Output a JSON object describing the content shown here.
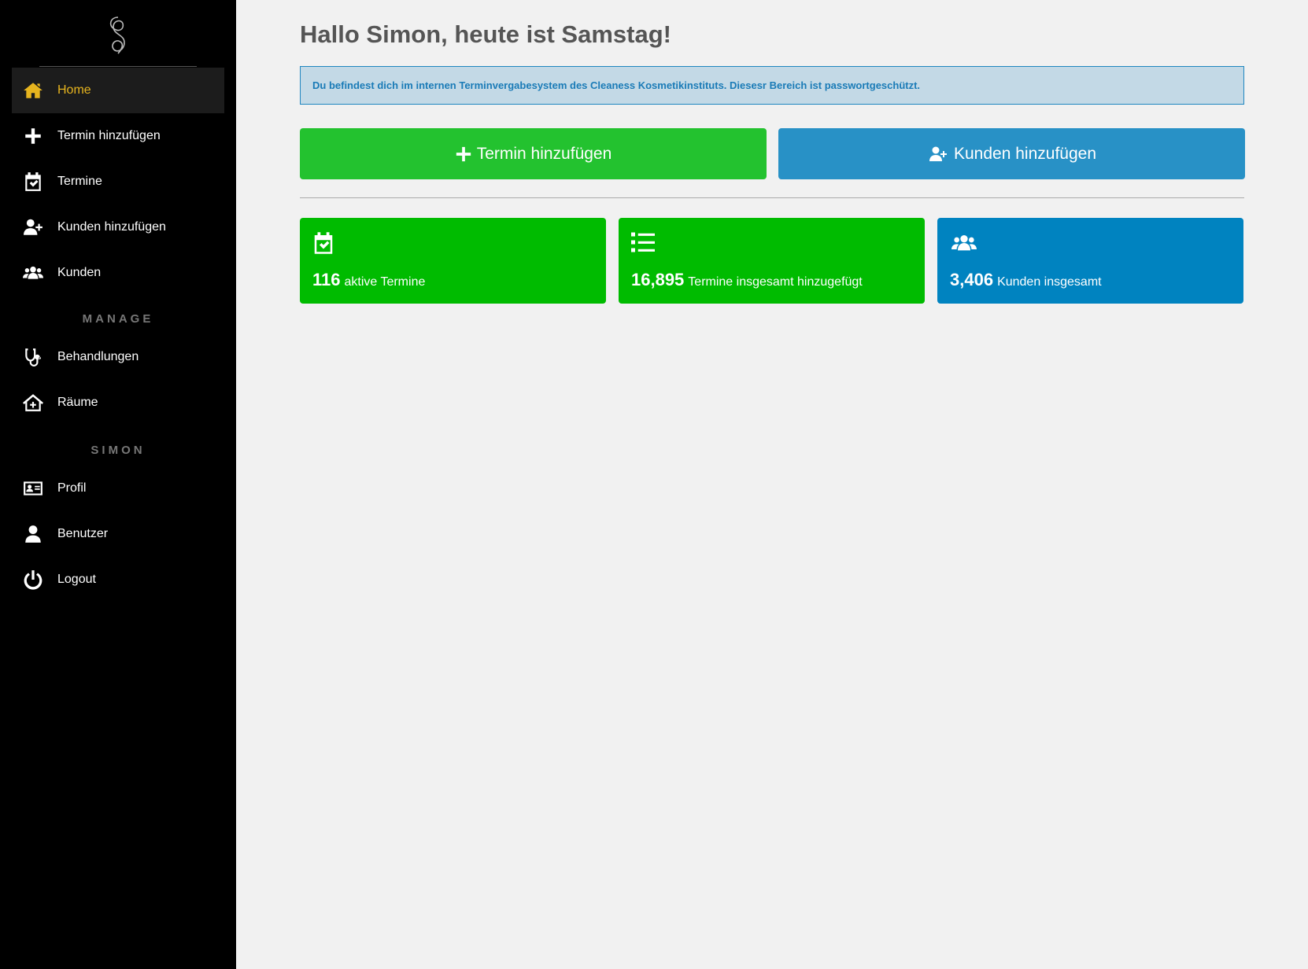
{
  "sidebar": {
    "logo": "logo-flourish",
    "items": [
      {
        "label": "Home",
        "icon": "home-icon"
      },
      {
        "label": "Termin hinzufügen",
        "icon": "plus-icon"
      },
      {
        "label": "Termine",
        "icon": "calendar-check-icon"
      },
      {
        "label": "Kunden hinzufügen",
        "icon": "user-plus-icon"
      },
      {
        "label": "Kunden",
        "icon": "users-icon"
      }
    ],
    "manage_label": "MANAGE",
    "manage_items": [
      {
        "label": "Behandlungen",
        "icon": "stethoscope-icon"
      },
      {
        "label": "Räume",
        "icon": "clinic-house-icon"
      }
    ],
    "user_label": "SIMON",
    "user_items": [
      {
        "label": "Profil",
        "icon": "id-card-icon"
      },
      {
        "label": "Benutzer",
        "icon": "user-icon"
      },
      {
        "label": "Logout",
        "icon": "power-icon"
      }
    ],
    "active_color": "#e6b41e"
  },
  "main": {
    "greeting": "Hallo Simon, heute ist Samstag!",
    "info": "Du befindest dich im internen Terminvergabesystem des Cleaness Kosmetikinstituts. Diesesr Bereich ist passwortgeschützt.",
    "buttons": {
      "add_appointment": "Termin hinzufügen",
      "add_customer": "Kunden hinzufügen"
    },
    "stats": [
      {
        "value": "116",
        "label": "aktive Termine",
        "icon": "calendar-check-icon",
        "color": "#00bb00"
      },
      {
        "value": "16,895",
        "label": "Termine insgesamt hinzugefügt",
        "icon": "list-icon",
        "color": "#00bb00"
      },
      {
        "value": "3,406",
        "label": "Kunden insgesamt",
        "icon": "users-icon",
        "color": "#0083c0"
      }
    ]
  },
  "colors": {
    "green_button": "#23c22f",
    "blue_button": "#2891c6",
    "info_bg": "#c3d9e6",
    "info_text": "#1a7bb7"
  }
}
